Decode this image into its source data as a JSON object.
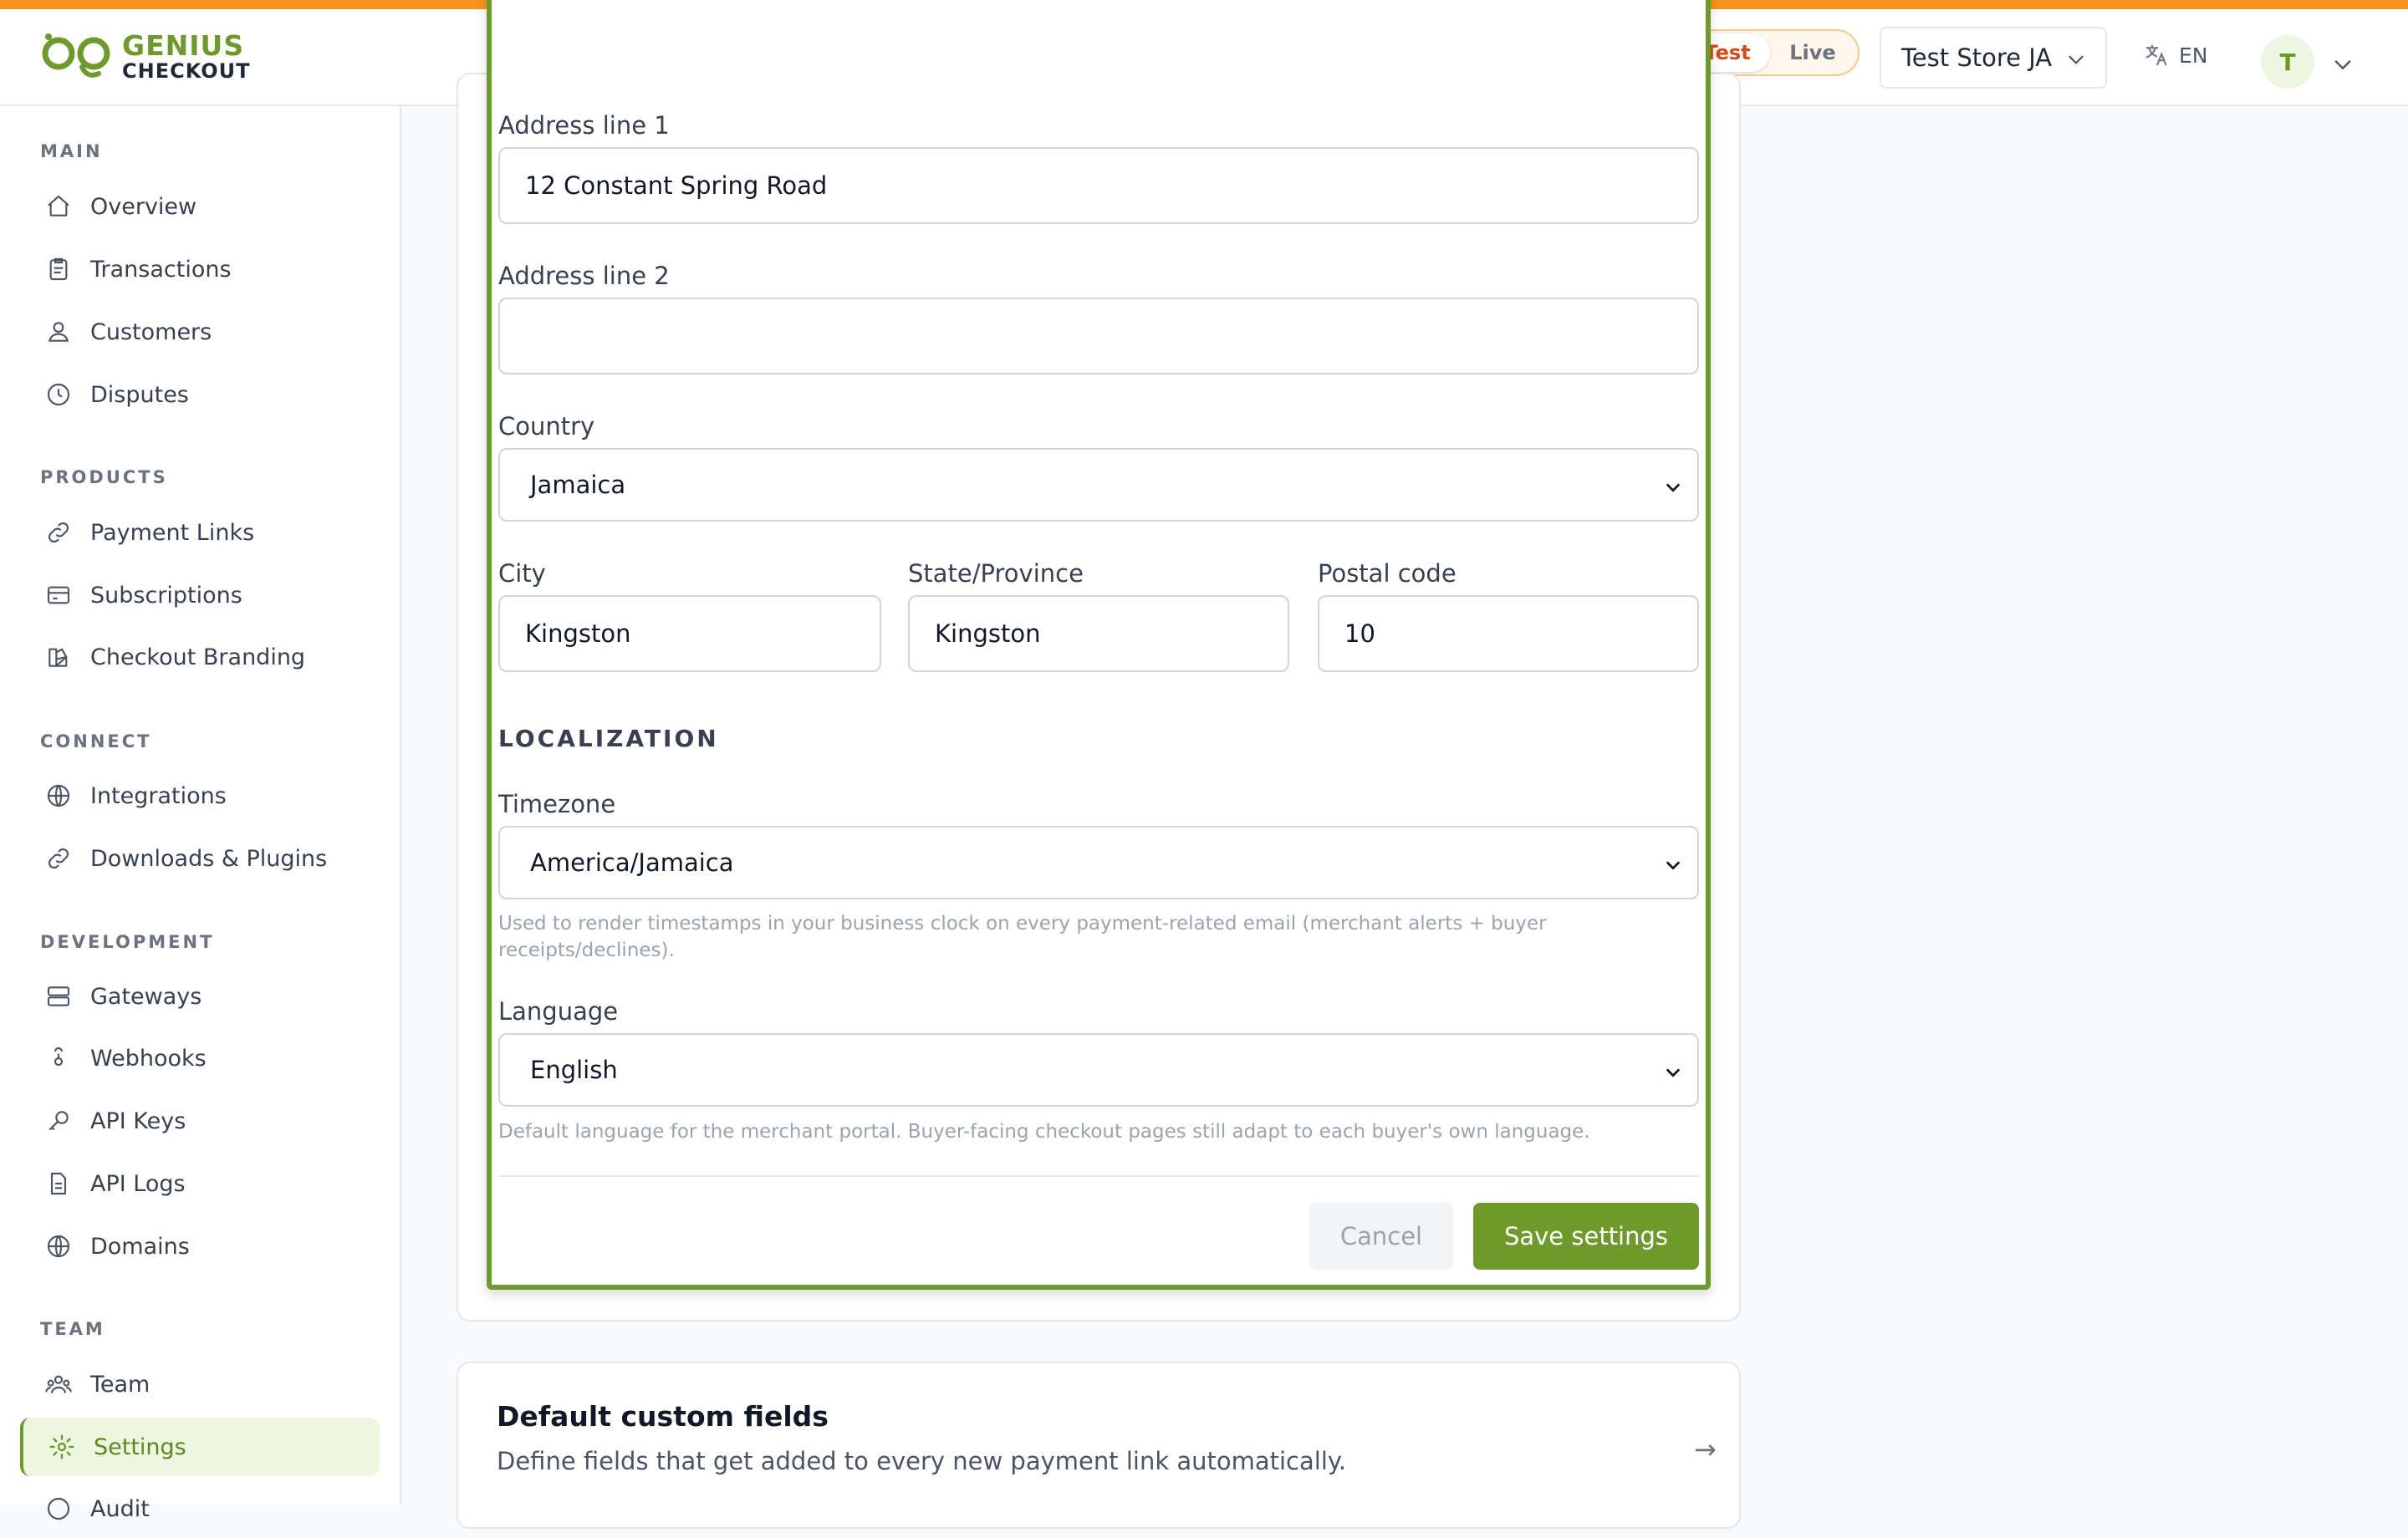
{
  "brand": {
    "logo_line1": "GENIUS",
    "logo_line2": "CHECKOUT",
    "accent_color": "#6e9a2b",
    "top_bar_color": "#f7931e"
  },
  "header": {
    "mode_test": "Test",
    "mode_live": "Live",
    "store_name": "Test Store JA",
    "language": "EN",
    "avatar_initial": "T"
  },
  "sidebar": {
    "sections": {
      "main": "MAIN",
      "products": "PRODUCTS",
      "connect": "CONNECT",
      "development": "DEVELOPMENT",
      "team": "TEAM"
    },
    "items": {
      "overview": "Overview",
      "transactions": "Transactions",
      "customers": "Customers",
      "disputes": "Disputes",
      "payment_links": "Payment Links",
      "subscriptions": "Subscriptions",
      "checkout_branding": "Checkout Branding",
      "integrations": "Integrations",
      "downloads_plugins": "Downloads & Plugins",
      "gateways": "Gateways",
      "webhooks": "Webhooks",
      "api_keys": "API Keys",
      "api_logs": "API Logs",
      "domains": "Domains",
      "team": "Team",
      "settings": "Settings",
      "audit_partial": "Audit"
    },
    "active_item": "Settings"
  },
  "form": {
    "address1_label": "Address line 1",
    "address1_value": "12 Constant Spring Road",
    "address2_label": "Address line 2",
    "address2_value": "",
    "country_label": "Country",
    "country_value": "Jamaica",
    "city_label": "City",
    "city_value": "Kingston",
    "state_label": "State/Province",
    "state_value": "Kingston",
    "postal_label": "Postal code",
    "postal_value": "10",
    "localization_heading": "LOCALIZATION",
    "timezone_label": "Timezone",
    "timezone_value": "America/Jamaica",
    "timezone_help_line1": "Used to render timestamps in your business clock on every payment-related email (merchant alerts + buyer",
    "timezone_help_line2": "receipts/declines).",
    "language_label": "Language",
    "language_value": "English",
    "language_help": "Default language for the merchant portal. Buyer-facing checkout pages still adapt to each buyer's own language.",
    "cancel_label": "Cancel",
    "save_label": "Save settings"
  },
  "custom_fields_card": {
    "title": "Default custom fields",
    "description": "Define fields that get added to every new payment link automatically.",
    "arrow": "→"
  }
}
